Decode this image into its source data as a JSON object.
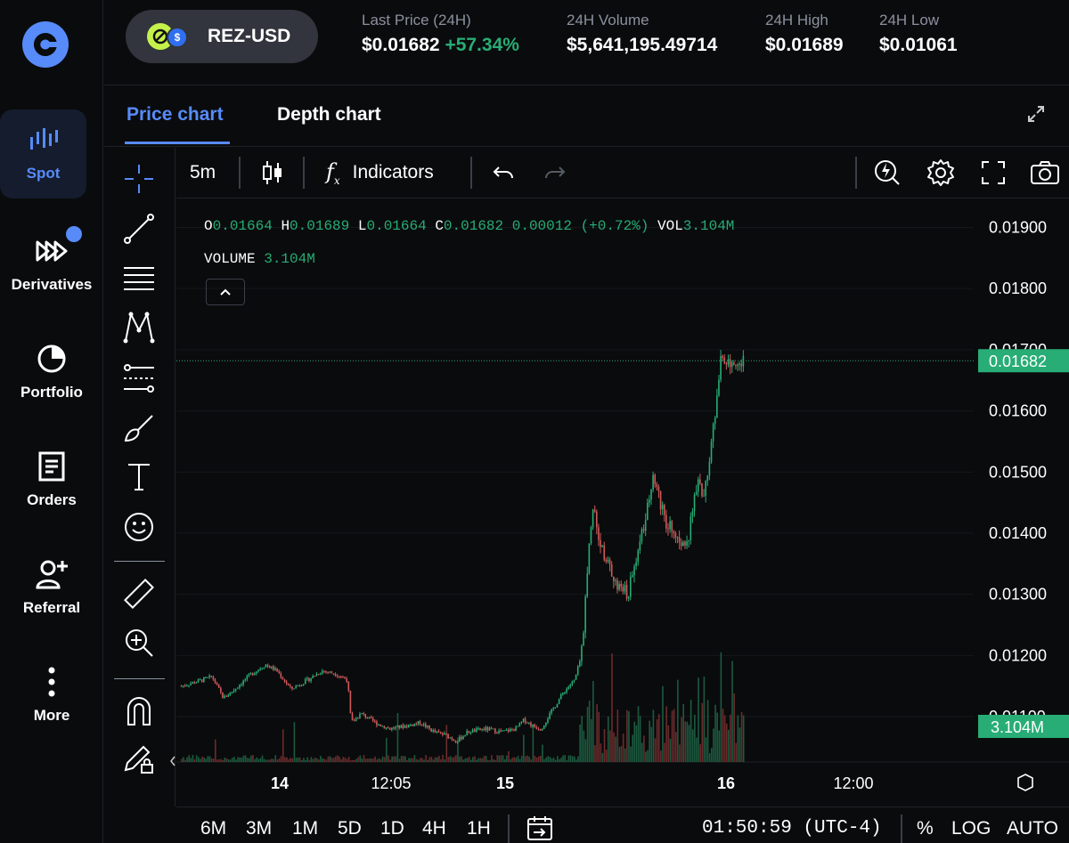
{
  "nav": {
    "items": [
      {
        "label": "Spot",
        "icon": "spot-chart-icon"
      },
      {
        "label": "Derivatives",
        "icon": "derivatives-icon"
      },
      {
        "label": "Portfolio",
        "icon": "portfolio-pie-icon"
      },
      {
        "label": "Orders",
        "icon": "orders-document-icon"
      },
      {
        "label": "Referral",
        "icon": "referral-user-plus-icon"
      },
      {
        "label": "More",
        "icon": "more-dots-icon"
      }
    ],
    "accent_color": "#578bfa"
  },
  "header": {
    "pair": "REZ-USD",
    "stats": [
      {
        "label": "Last Price (24H)",
        "value": "$0.01682",
        "change": "+57.34%"
      },
      {
        "label": "24H Volume",
        "value": "$5,641,195.49714"
      },
      {
        "label": "24H High",
        "value": "$0.01689"
      },
      {
        "label": "24H Low",
        "value": "$0.01061"
      }
    ]
  },
  "tabs": [
    {
      "label": "Price chart",
      "active": true
    },
    {
      "label": "Depth chart",
      "active": false
    }
  ],
  "toolbar": {
    "interval": "5m",
    "indicators_label": "Indicators"
  },
  "legend": {
    "o_label": "O",
    "o": "0.01664",
    "h_label": "H",
    "h": "0.01689",
    "l_label": "L",
    "l": "0.01664",
    "c_label": "C",
    "c": "0.01682",
    "change": "0.00012 (+0.72%)",
    "vol_label": "VOL",
    "vol": "3.104M",
    "volume_label": "VOLUME",
    "volume": "3.104M"
  },
  "chart_data": {
    "type": "candlestick",
    "y_ticks": [
      "0.01900",
      "0.01800",
      "0.01700",
      "0.01600",
      "0.01500",
      "0.01400",
      "0.01300",
      "0.01200",
      "0.01100"
    ],
    "ylim": [
      0.0102,
      0.0194
    ],
    "x_ticks": [
      "14",
      "12:05",
      "15",
      "16",
      "12:00"
    ],
    "last_price_label": "0.01682",
    "volume_label": "3.104M",
    "price_path": [
      [
        0.0,
        0.0115
      ],
      [
        0.03,
        0.01158
      ],
      [
        0.055,
        0.01165
      ],
      [
        0.075,
        0.0113
      ],
      [
        0.095,
        0.01145
      ],
      [
        0.125,
        0.0117
      ],
      [
        0.15,
        0.01185
      ],
      [
        0.17,
        0.01175
      ],
      [
        0.195,
        0.01145
      ],
      [
        0.225,
        0.0116
      ],
      [
        0.25,
        0.01175
      ],
      [
        0.275,
        0.0117
      ],
      [
        0.296,
        0.0116
      ],
      [
        0.3,
        0.0111
      ],
      [
        0.303,
        0.0109
      ],
      [
        0.32,
        0.01105
      ],
      [
        0.345,
        0.0109
      ],
      [
        0.37,
        0.0108
      ],
      [
        0.4,
        0.01085
      ],
      [
        0.425,
        0.0109
      ],
      [
        0.45,
        0.01075
      ],
      [
        0.47,
        0.0107
      ],
      [
        0.49,
        0.0106
      ],
      [
        0.51,
        0.01075
      ],
      [
        0.54,
        0.0108
      ],
      [
        0.57,
        0.01075
      ],
      [
        0.595,
        0.0108
      ],
      [
        0.61,
        0.01095
      ],
      [
        0.625,
        0.01085
      ],
      [
        0.64,
        0.0108
      ],
      [
        0.66,
        0.0111
      ],
      [
        0.68,
        0.0114
      ],
      [
        0.7,
        0.0116
      ],
      [
        0.712,
        0.012
      ],
      [
        0.72,
        0.013
      ],
      [
        0.725,
        0.0138
      ],
      [
        0.73,
        0.0142
      ],
      [
        0.735,
        0.0145
      ],
      [
        0.74,
        0.0141
      ],
      [
        0.75,
        0.0137
      ],
      [
        0.765,
        0.0134
      ],
      [
        0.78,
        0.0131
      ],
      [
        0.795,
        0.013
      ],
      [
        0.81,
        0.0136
      ],
      [
        0.82,
        0.014
      ],
      [
        0.83,
        0.0145
      ],
      [
        0.84,
        0.015
      ],
      [
        0.85,
        0.0146
      ],
      [
        0.86,
        0.0142
      ],
      [
        0.875,
        0.0141
      ],
      [
        0.89,
        0.0139
      ],
      [
        0.9,
        0.0138
      ],
      [
        0.91,
        0.0144
      ],
      [
        0.92,
        0.0148
      ],
      [
        0.93,
        0.0146
      ],
      [
        0.94,
        0.0152
      ],
      [
        0.95,
        0.016
      ],
      [
        0.96,
        0.01682
      ]
    ]
  },
  "bottom_bar": {
    "ranges": [
      "6M",
      "3M",
      "1M",
      "5D",
      "1D",
      "4H",
      "1H"
    ],
    "clock": "01:50:59 (UTC-4)",
    "percent": "%",
    "log": "LOG",
    "auto": "AUTO"
  }
}
